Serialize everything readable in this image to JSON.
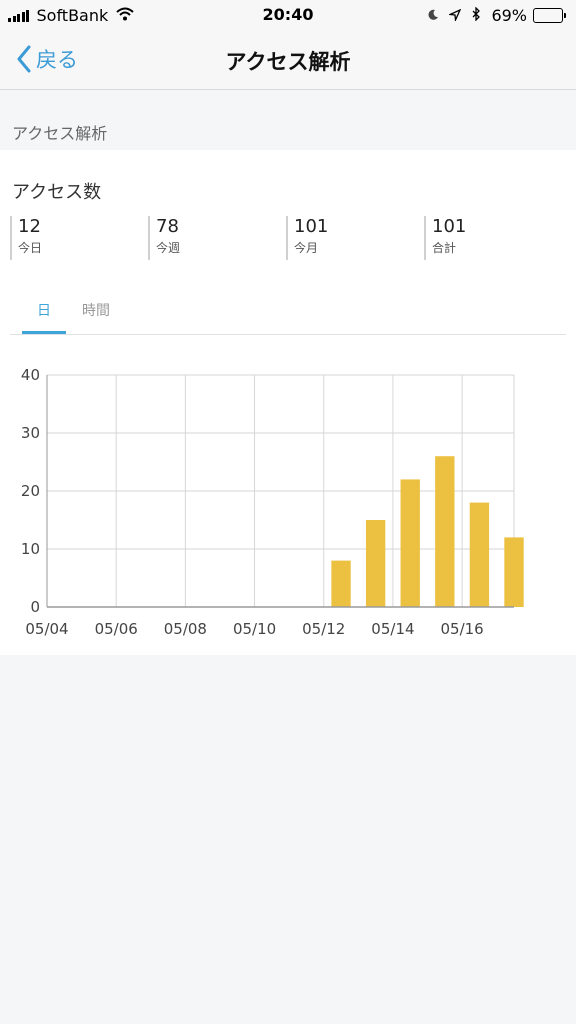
{
  "status_bar": {
    "carrier": "SoftBank",
    "time": "20:40",
    "battery_percent": "69%",
    "battery_level": 0.69,
    "icons": [
      "signal-icon",
      "wifi-icon",
      "moon-icon",
      "location-icon",
      "bluetooth-icon",
      "battery-icon"
    ]
  },
  "nav": {
    "back_label": "戻る",
    "title": "アクセス解析"
  },
  "section": {
    "header": "アクセス解析"
  },
  "card": {
    "title": "アクセス数",
    "stats": [
      {
        "value": "12",
        "label": "今日"
      },
      {
        "value": "78",
        "label": "今週"
      },
      {
        "value": "101",
        "label": "今月"
      },
      {
        "value": "101",
        "label": "合計"
      }
    ],
    "tabs": [
      {
        "label": "日",
        "active": true
      },
      {
        "label": "時間",
        "active": false
      }
    ]
  },
  "colors": {
    "accent": "#3fa4d8",
    "bar": "#ecc142",
    "grid": "#d6d6d6"
  },
  "chart_data": {
    "type": "bar",
    "x": [
      "05/04",
      "05/05",
      "05/06",
      "05/07",
      "05/08",
      "05/09",
      "05/10",
      "05/11",
      "05/12",
      "05/13",
      "05/14",
      "05/15",
      "05/16",
      "05/17"
    ],
    "values": [
      0,
      0,
      0,
      0,
      0,
      0,
      0,
      0,
      8,
      15,
      22,
      26,
      18,
      12
    ],
    "x_tick_labels": [
      "05/04",
      "05/06",
      "05/08",
      "05/10",
      "05/12",
      "05/14",
      "05/16"
    ],
    "y_ticks": [
      0,
      10,
      20,
      30,
      40
    ],
    "ylim": [
      0,
      40
    ],
    "grid": true
  }
}
